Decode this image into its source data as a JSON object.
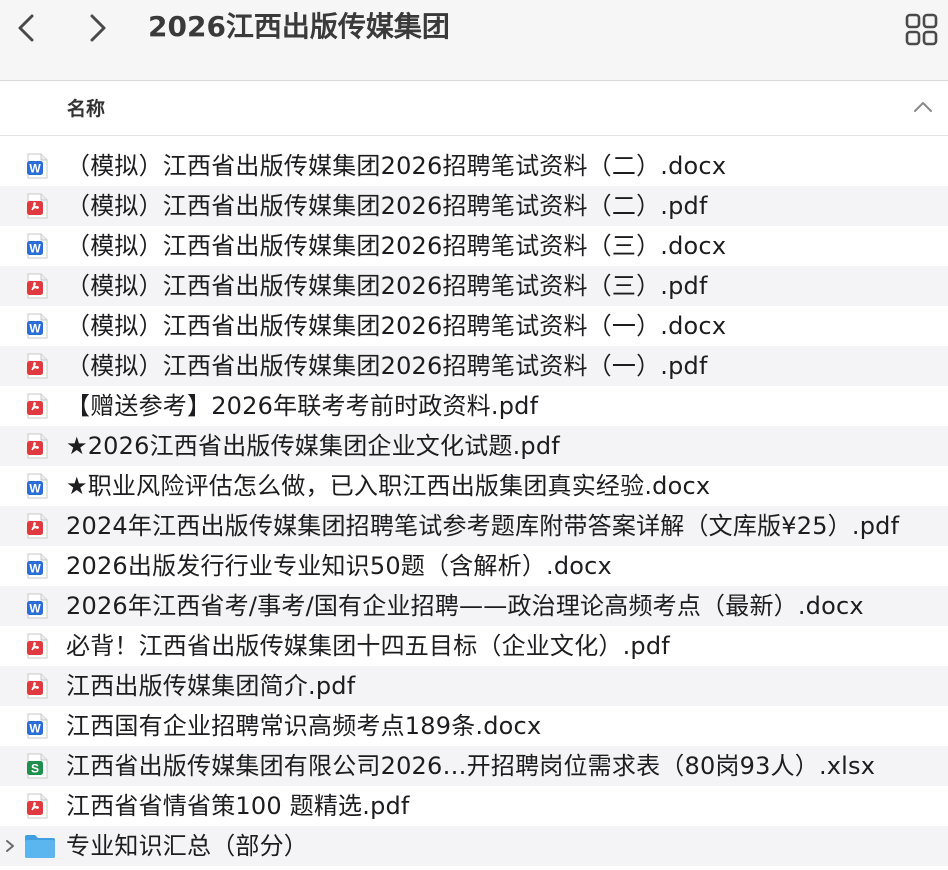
{
  "window": {
    "title": "2026江西出版传媒集团"
  },
  "toolbar": {
    "back": "back-chevron-icon",
    "forward": "forward-chevron-icon",
    "view": "grid-view-icon"
  },
  "columns": {
    "name_header": "名称",
    "sort": "chevron-up-icon"
  },
  "colors": {
    "word": "#2b6fd6",
    "pdf": "#e0393e",
    "excel": "#1f8f4e",
    "folder": "#5bb6f0",
    "stripe": "#f4f4f6"
  },
  "files": [
    {
      "name": "（模拟）江西省出版传媒集团2026招聘笔试资料（二）.docx",
      "icon": "word-doc-icon"
    },
    {
      "name": "（模拟）江西省出版传媒集团2026招聘笔试资料（二）.pdf",
      "icon": "pdf-doc-icon"
    },
    {
      "name": "（模拟）江西省出版传媒集团2026招聘笔试资料（三）.docx",
      "icon": "word-doc-icon"
    },
    {
      "name": "（模拟）江西省出版传媒集团2026招聘笔试资料（三）.pdf",
      "icon": "pdf-doc-icon"
    },
    {
      "name": "（模拟）江西省出版传媒集团2026招聘笔试资料（一）.docx",
      "icon": "word-doc-icon"
    },
    {
      "name": "（模拟）江西省出版传媒集团2026招聘笔试资料（一）.pdf",
      "icon": "pdf-doc-icon"
    },
    {
      "name": "【赠送参考】2026年联考考前时政资料.pdf",
      "icon": "pdf-doc-icon"
    },
    {
      "name": "★2026江西省出版传媒集团企业文化试题.pdf",
      "icon": "pdf-doc-icon"
    },
    {
      "name": "★职业风险评估怎么做，已入职江西出版集团真实经验.docx",
      "icon": "word-doc-icon"
    },
    {
      "name": "2024年江西出版传媒集团招聘笔试参考题库附带答案详解（文库版¥25）.pdf",
      "icon": "pdf-doc-icon"
    },
    {
      "name": "2026出版发行行业专业知识50题（含解析）.docx",
      "icon": "word-doc-icon"
    },
    {
      "name": "2026年江西省考/事考/国有企业招聘——政治理论高频考点（最新）.docx",
      "icon": "word-doc-icon"
    },
    {
      "name": "必背！江西省出版传媒集团十四五目标（企业文化）.pdf",
      "icon": "pdf-doc-icon"
    },
    {
      "name": "江西出版传媒集团简介.pdf",
      "icon": "pdf-doc-icon"
    },
    {
      "name": "江西国有企业招聘常识高频考点189条.docx",
      "icon": "word-doc-icon"
    },
    {
      "name": "江西省出版传媒集团有限公司2026…开招聘岗位需求表（80岗93人）.xlsx",
      "icon": "excel-doc-icon"
    },
    {
      "name": "江西省省情省策100 题精选.pdf",
      "icon": "pdf-doc-icon"
    },
    {
      "name": "专业知识汇总（部分）",
      "icon": "folder-icon"
    }
  ],
  "icon_letters": {
    "word": "W",
    "excel": "S"
  }
}
